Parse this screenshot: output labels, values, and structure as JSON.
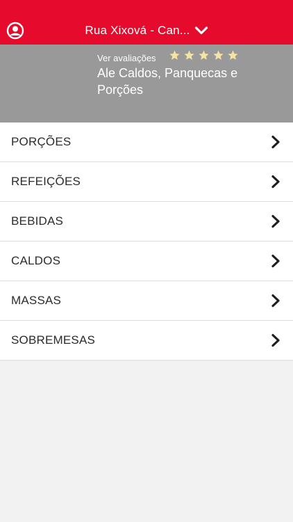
{
  "header": {
    "address": "Rua Xixová - Can...",
    "user_icon": "user-circle-icon",
    "dropdown_icon": "chevron-down-icon",
    "background_color": "#e60a2d"
  },
  "store": {
    "reviews_link": "Ver avaliações",
    "rating": 5,
    "rating_max": 5,
    "name": "Ale Caldos, Panquecas e Porções",
    "star_color": "#f3e4a2"
  },
  "categories": [
    {
      "label": "PORÇÕES"
    },
    {
      "label": "REFEIÇÕES"
    },
    {
      "label": "BEBIDAS"
    },
    {
      "label": "CALDOS"
    },
    {
      "label": "MASSAS"
    },
    {
      "label": "SOBREMESAS"
    }
  ]
}
